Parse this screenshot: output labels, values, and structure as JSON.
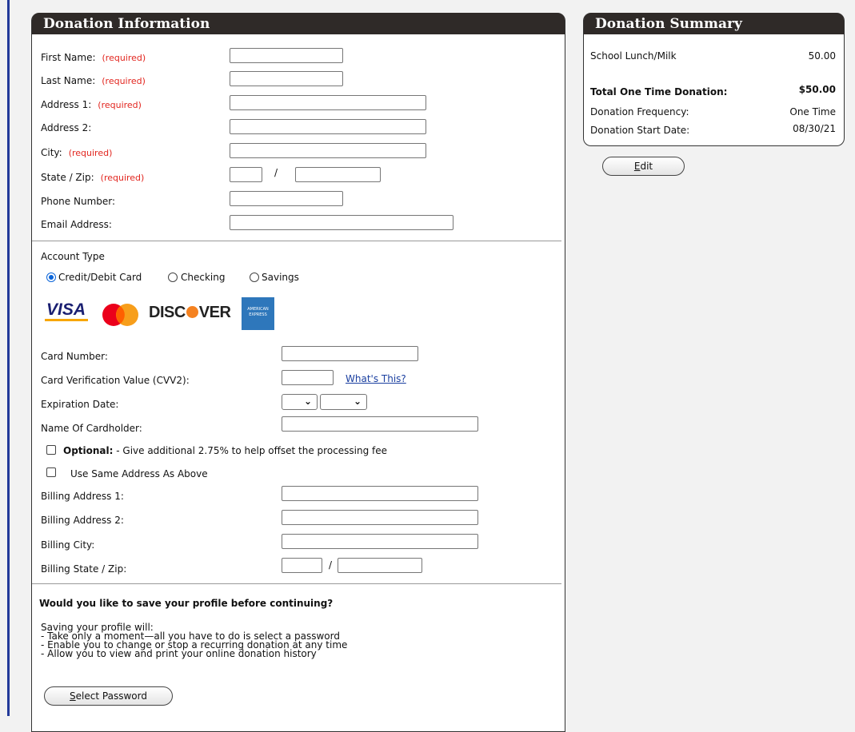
{
  "donation_info": {
    "title": "Donation Information",
    "required_tag": "(required)",
    "fields": {
      "first_name": "First Name:",
      "last_name": "Last Name:",
      "address1": "Address 1:",
      "address2": "Address 2:",
      "city": "City:",
      "state_zip": "State / Zip:",
      "phone": "Phone Number:",
      "email": "Email Address:"
    },
    "slash": "/"
  },
  "account": {
    "type_label": "Account Type",
    "options": [
      "Credit/Debit Card",
      "Checking",
      "Savings"
    ],
    "selected": "Credit/Debit Card",
    "card_logos": {
      "visa": "VISA",
      "discover_a": "DISC",
      "discover_b": "VER",
      "amex_a": "AMERICAN",
      "amex_b": "EXPRESS"
    },
    "card_number": "Card Number:",
    "cvv": "Card Verification Value (CVV2):",
    "whats_this": "What's This?",
    "expiration": "Expiration Date:",
    "cardholder": "Name Of Cardholder:",
    "optional_bold": "Optional:",
    "optional_text": " - Give additional 2.75% to help offset the processing fee",
    "same_address": "Use Same Address As Above",
    "billing_address1": "Billing Address 1:",
    "billing_address2": "Billing Address 2:",
    "billing_city": "Billing City:",
    "billing_state_zip": "Billing State / Zip:"
  },
  "profile": {
    "question": "Would you like to save your profile before continuing?",
    "intro": "Saving your profile will:",
    "bullets": [
      "- Take only a moment—all you have to do is select a password",
      "- Enable you to change or stop a recurring donation at any time",
      "- Allow you to view and print your online donation history"
    ],
    "button_underlined": "S",
    "button_rest": "elect Password"
  },
  "summary": {
    "title": "Donation Summary",
    "item_label": "School Lunch/Milk",
    "item_value": "50.00",
    "total_label": "Total One Time Donation:",
    "total_value": "$50.00",
    "frequency_label": "Donation Frequency:",
    "frequency_value": "One Time",
    "start_label": "Donation Start Date:",
    "start_value": "08/30/21",
    "edit_underlined": "E",
    "edit_rest": "dit"
  },
  "colors": {
    "header_bg": "#2f2a28",
    "required": "#e2261f",
    "link": "#1a3fa0",
    "radio_selected": "#0a64d8"
  }
}
